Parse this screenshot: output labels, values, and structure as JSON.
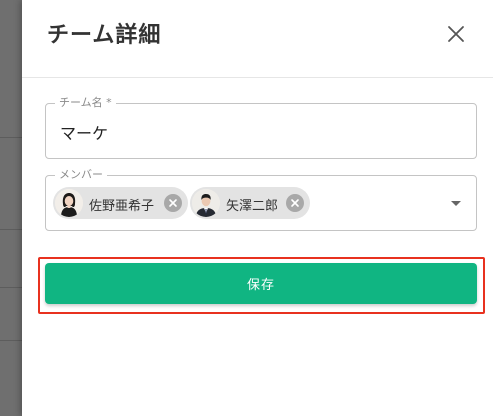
{
  "dialog": {
    "title": "チーム詳細",
    "close_icon": "close-icon"
  },
  "form": {
    "team_name": {
      "label": "チーム名 *",
      "value": "マーケ"
    },
    "members": {
      "label": "メンバー",
      "chips": [
        {
          "name": "佐野亜希子",
          "avatar_icon": "avatar-woman"
        },
        {
          "name": "矢澤二郎",
          "avatar_icon": "avatar-man"
        }
      ],
      "dropdown_icon": "arrow-drop-down-icon"
    },
    "save_label": "保存"
  },
  "colors": {
    "primary": "#10b582",
    "highlight": "#e8311f",
    "chip_bg": "#e3e3e3"
  }
}
